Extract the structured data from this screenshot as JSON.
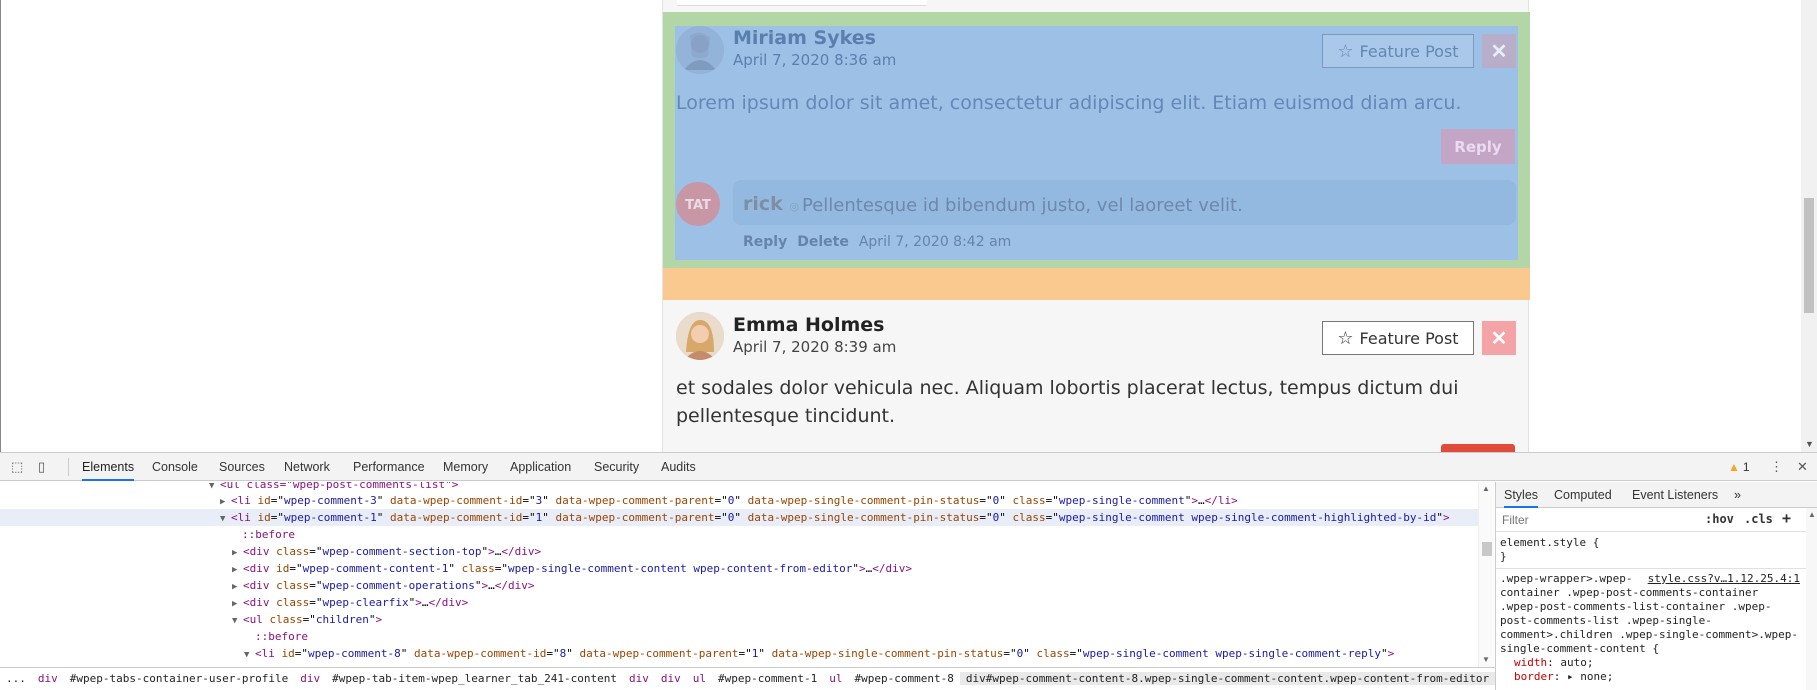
{
  "page": {
    "comment1": {
      "author": "Miriam Sykes",
      "date": "April 7, 2020 8:36 am",
      "feature_label": "Feature Post",
      "body": "Lorem ipsum dolor sit amet, consectetur adipiscing elit. Etiam euismod diam arcu.",
      "reply_label": "Reply",
      "reply": {
        "author": "rick",
        "text": "Pellentesque id bibendum justo, vel laoreet velit.",
        "reply_link": "Reply",
        "delete_link": "Delete",
        "date": "April 7, 2020 8:42 am"
      }
    },
    "comment2": {
      "author": "Emma Holmes",
      "date": "April 7, 2020 8:39 am",
      "feature_label": "Feature Post",
      "body_line1": "et sodales dolor vehicula nec. Aliquam lobortis placerat lectus, tempus dictum dui",
      "body_line2": "pellentesque tincidunt."
    },
    "delete_glyph": "✕",
    "star_glyph": "☆"
  },
  "devtools": {
    "tabs": [
      "Elements",
      "Console",
      "Sources",
      "Network",
      "Performance",
      "Memory",
      "Application",
      "Security",
      "Audits"
    ],
    "active_tab": "Elements",
    "warning_count": "1",
    "styles_tabs": [
      "Styles",
      "Computed",
      "Event Listeners",
      "»"
    ],
    "filter_placeholder": "Filter",
    "hov": ":hov",
    "cls": ".cls",
    "plus": "+",
    "element_style": "element.style {",
    "close_brace": "}",
    "style_source": "style.css?v…1.12.25.4:1",
    "selector_lines": [
      ".wpep-wrapper>.wpep-",
      "container .wpep-post-comments-container",
      ".wpep-post-comments-list-container .wpep-",
      "post-comments-list .wpep-single-",
      "comment>.children .wpep-single-comment>.wpep-",
      "single-comment-content {"
    ],
    "prop1_name": "width",
    "prop1_value": "auto;",
    "prop2_name": "border",
    "prop2_value": "▸ none;",
    "breadcrumb": [
      "...",
      "div",
      "#wpep-tabs-container-user-profile",
      "div",
      "#wpep-tab-item-wpep_learner_tab_241-content",
      "div",
      "div",
      "ul",
      "#wpep-comment-1",
      "ul",
      "#wpep-comment-8",
      "div#wpep-comment-content-8.wpep-single-comment-content.wpep-content-from-editor"
    ],
    "dom": {
      "l0": "ul class=\"wpep-post-comments-list\"",
      "l1_id": "wpep-comment-3",
      "l1_cid": "3",
      "l1_parent": "0",
      "l1_pin": "0",
      "l1_class": "wpep-single-comment",
      "l2_id": "wpep-comment-1",
      "l2_cid": "1",
      "l2_parent": "0",
      "l2_pin": "0",
      "l2_class": "wpep-single-comment wpep-single-comment-highlighted-by-id",
      "before": "::before",
      "l4_class": "wpep-comment-section-top",
      "l5_id": "wpep-comment-content-1",
      "l5_class": "wpep-single-comment-content wpep-content-from-editor",
      "l6_class": "wpep-comment-operations",
      "l7_class": "wpep-clearfix",
      "l8_class": "children",
      "l10_id": "wpep-comment-8",
      "l10_cid": "8",
      "l10_parent": "1",
      "l10_pin": "0",
      "l10_class": "wpep-single-comment wpep-single-comment-reply"
    }
  }
}
